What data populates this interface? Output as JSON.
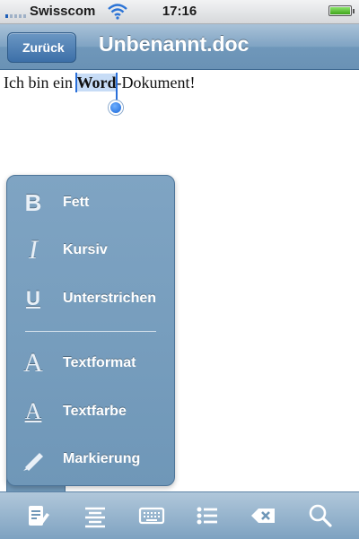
{
  "status_bar": {
    "carrier": "Swisscom",
    "time": "17:16",
    "signal_bars": 1,
    "battery_fraction": 1.0
  },
  "nav": {
    "back_label": "Zurück",
    "title": "Unbenannt.doc"
  },
  "document": {
    "before": "Ich bin ein ",
    "selected": "Word",
    "after": "-Dokument!"
  },
  "format_menu": {
    "items": [
      {
        "icon": "bold-icon",
        "label": "Fett"
      },
      {
        "icon": "italic-icon",
        "label": "Kursiv"
      },
      {
        "icon": "underline-icon",
        "label": "Unterstrichen"
      },
      {
        "icon": "text-format-icon",
        "label": "Textformat"
      },
      {
        "icon": "text-color-icon",
        "label": "Textfarbe"
      },
      {
        "icon": "highlighter-icon",
        "label": "Markierung"
      }
    ]
  },
  "toolbar": {
    "items": [
      "format-icon",
      "align-icon",
      "keyboard-icon",
      "list-icon",
      "delete-icon",
      "search-icon"
    ]
  },
  "colors": {
    "accent": "#6f97b8",
    "selection": "#c7dcf6",
    "caret": "#2a6fd9"
  }
}
